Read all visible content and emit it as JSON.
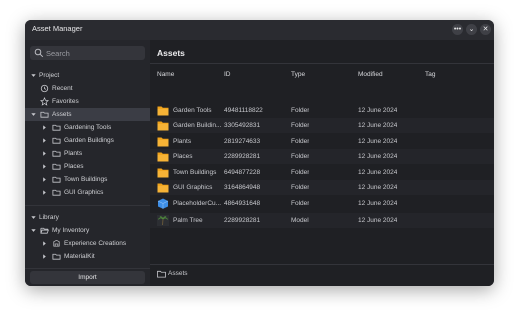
{
  "window": {
    "title": "Asset Manager"
  },
  "titlebar_buttons": {
    "more": "•••",
    "collapse": "⌄",
    "close": "✕"
  },
  "search": {
    "placeholder": "Search"
  },
  "sidebar": {
    "project_label": "Project",
    "recent_label": "Recent",
    "favorites_label": "Favorites",
    "assets_label": "Assets",
    "asset_folders": [
      "Gardening Tools",
      "Garden Buildings",
      "Plants",
      "Places",
      "Town Buildings",
      "GUI Graphics"
    ],
    "library_label": "Library",
    "my_inventory_label": "My Inventory",
    "inventory_items": [
      "Experience Creations",
      "MaterialKit"
    ],
    "import_label": "Import"
  },
  "main": {
    "title": "Assets",
    "columns": {
      "name": "Name",
      "id": "ID",
      "type": "Type",
      "modified": "Modified",
      "tag": "Tag"
    },
    "rows": [
      {
        "name": "Garden Tools",
        "id": "49481118822",
        "type": "Folder",
        "modified": "12 June 2024",
        "icon": "folder"
      },
      {
        "name": "Garden Buildin...",
        "id": "3305492831",
        "type": "Folder",
        "modified": "12 June 2024",
        "icon": "folder"
      },
      {
        "name": "Plants",
        "id": "2819274633",
        "type": "Folder",
        "modified": "12 June 2024",
        "icon": "folder"
      },
      {
        "name": "Places",
        "id": "2289928281",
        "type": "Folder",
        "modified": "12 June 2024",
        "icon": "folder"
      },
      {
        "name": "Town Buildings",
        "id": "6494877228",
        "type": "Folder",
        "modified": "12 June 2024",
        "icon": "folder"
      },
      {
        "name": "GUI Graphics",
        "id": "3164864948",
        "type": "Folder",
        "modified": "12 June 2024",
        "icon": "folder"
      },
      {
        "name": "PlaceholderCu...",
        "id": "4864931648",
        "type": "Folder",
        "modified": "12 June 2024",
        "icon": "cube"
      },
      {
        "name": "Palm Tree",
        "id": "2289928281",
        "type": "Model",
        "modified": "12 June 2024",
        "icon": "model"
      }
    ],
    "footer_path": "Assets"
  },
  "colors": {
    "folder": "#f0a21a",
    "cube": "#3d8ee6",
    "selected_bg": "#3b3d45"
  }
}
